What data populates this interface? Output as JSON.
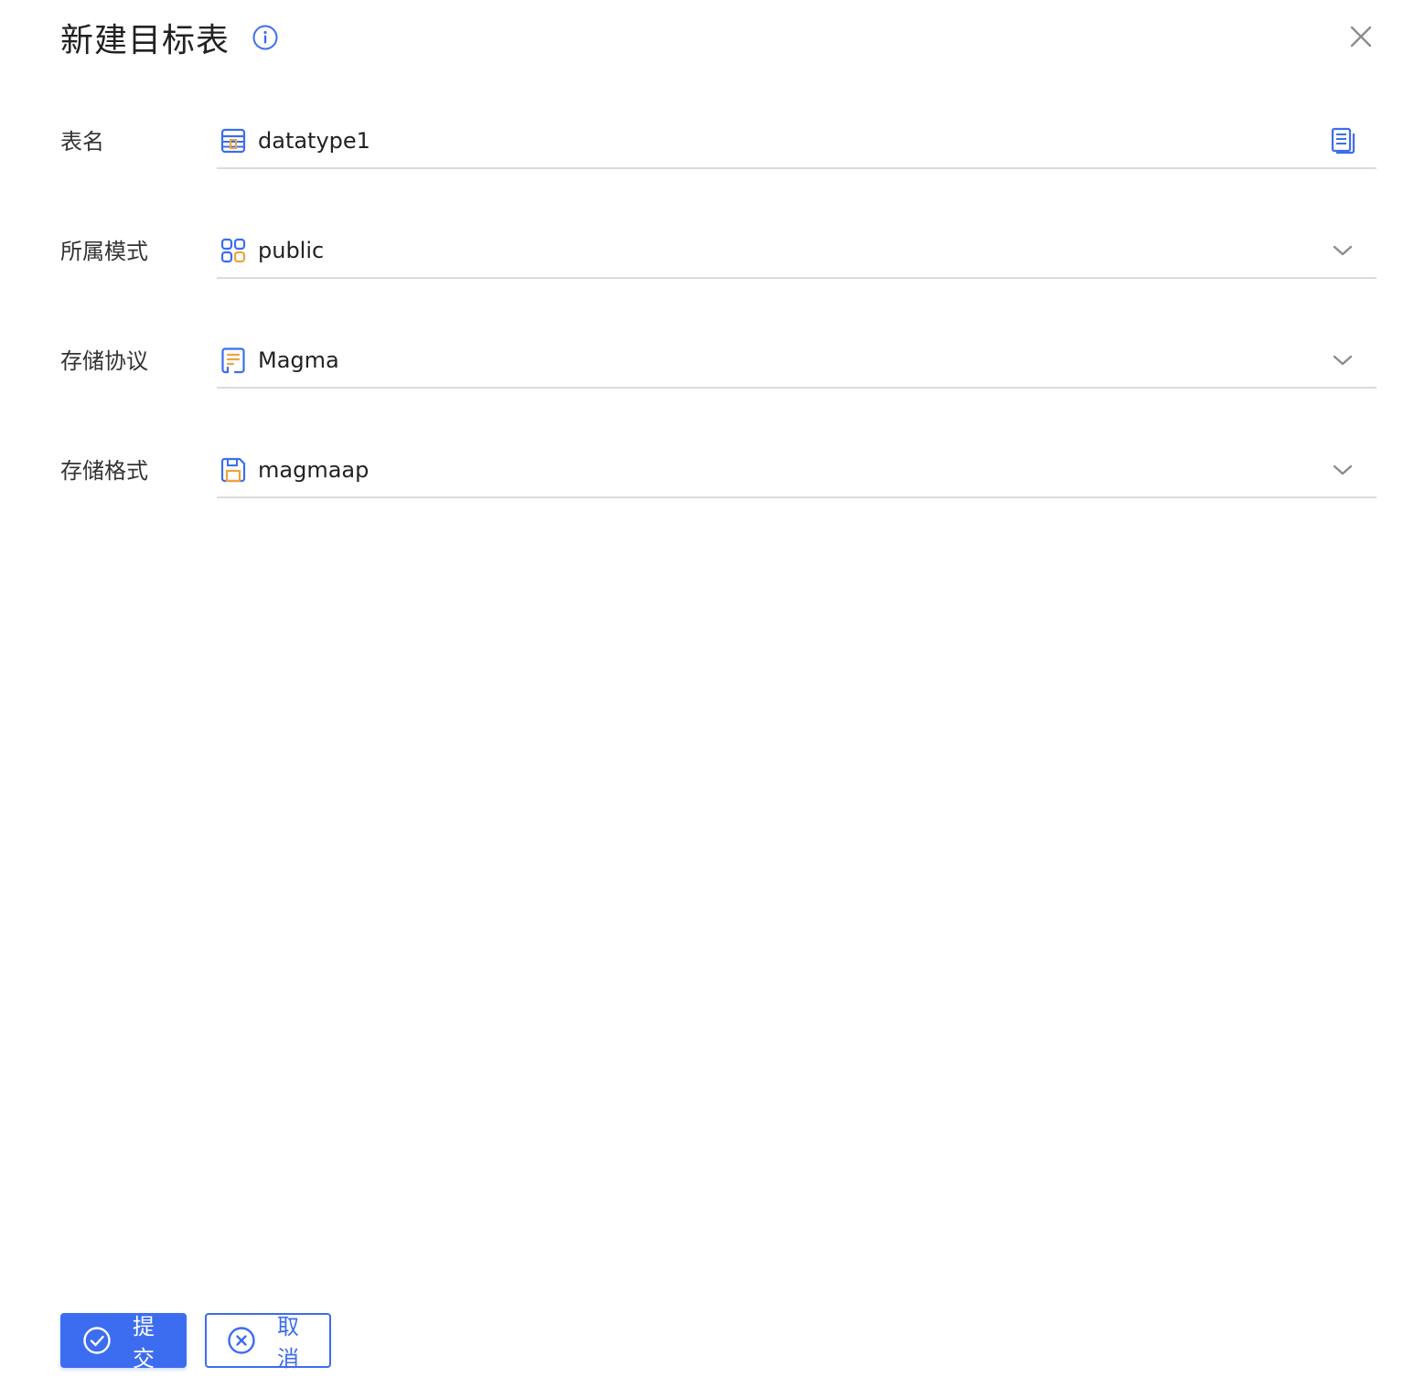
{
  "dialog": {
    "title": "新建目标表",
    "info_icon": "info-circle-icon",
    "close_icon": "close-icon"
  },
  "form": {
    "table_name": {
      "label": "表名",
      "value": "datatype1",
      "icon": "table-icon",
      "trailing_icon": "copy-document-icon"
    },
    "schema": {
      "label": "所属模式",
      "value": "public",
      "icon": "grid-apps-icon",
      "trailing_icon": "chevron-down-icon"
    },
    "storage_protocol": {
      "label": "存储协议",
      "value": "Magma",
      "icon": "document-list-icon",
      "trailing_icon": "chevron-down-icon"
    },
    "storage_format": {
      "label": "存储格式",
      "value": "magmaap",
      "icon": "save-disk-icon",
      "trailing_icon": "chevron-down-icon"
    }
  },
  "footer": {
    "submit_label": "提交",
    "cancel_label": "取消"
  },
  "colors": {
    "primary": "#3c6df0",
    "accent_orange": "#f0a23c",
    "divider": "#dcdcdc",
    "icon_gray": "#8c8c8c"
  }
}
